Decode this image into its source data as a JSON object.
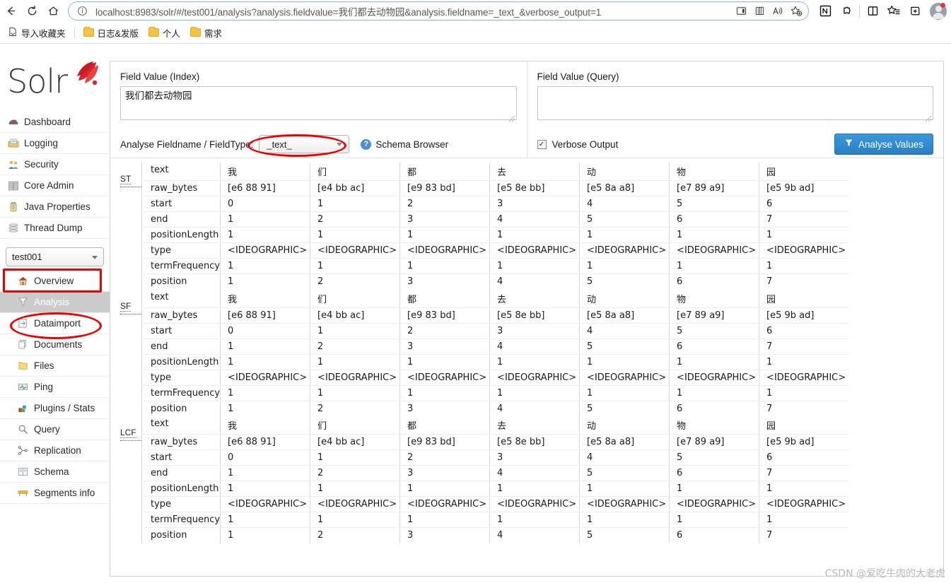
{
  "browser": {
    "back_label": "Back",
    "refresh_label": "Refresh",
    "home_label": "Home",
    "url_host": "localhost",
    "url_rest": ":8983/solr/#/test001/analysis?analysis.fieldvalue=我们都去动物园&analysis.fieldname=_text_&verbose_output=1",
    "url_full": "localhost:8983/solr/#/test001/analysis?analysis.fieldvalue=我们都去动物园&analysis.fieldname=_text_&verbose_output=1",
    "addr_icons": [
      "split-screen-icon",
      "collections-icon",
      "read-aloud-icon",
      "add-favorite-icon"
    ],
    "ext_icons": [
      "notion-icon",
      "extensions-icon",
      "split-pane-icon",
      "favorites-icon",
      "add-tab-icon"
    ],
    "bookmarks": [
      {
        "label": "导入收藏夹",
        "icon": "import-favorites-icon"
      },
      {
        "label": "日志&发版",
        "icon": "folder-icon"
      },
      {
        "label": "个人",
        "icon": "folder-icon"
      },
      {
        "label": "需求",
        "icon": "folder-icon"
      }
    ]
  },
  "sidebar": {
    "logo_text": "Solr",
    "global_items": [
      {
        "label": "Dashboard",
        "icon": "dashboard-icon"
      },
      {
        "label": "Logging",
        "icon": "logging-icon"
      },
      {
        "label": "Security",
        "icon": "security-icon"
      },
      {
        "label": "Core Admin",
        "icon": "core-admin-icon"
      },
      {
        "label": "Java Properties",
        "icon": "java-properties-icon"
      },
      {
        "label": "Thread Dump",
        "icon": "thread-dump-icon"
      }
    ],
    "core_selector_value": "test001",
    "core_items": [
      {
        "label": "Overview",
        "icon": "home-icon",
        "active": false
      },
      {
        "label": "Analysis",
        "icon": "funnel-icon",
        "active": true
      },
      {
        "label": "Dataimport",
        "icon": "dataimport-icon",
        "active": false
      },
      {
        "label": "Documents",
        "icon": "documents-icon",
        "active": false
      },
      {
        "label": "Files",
        "icon": "files-icon",
        "active": false
      },
      {
        "label": "Ping",
        "icon": "ping-icon",
        "active": false
      },
      {
        "label": "Plugins / Stats",
        "icon": "plugins-icon",
        "active": false
      },
      {
        "label": "Query",
        "icon": "magnifier-icon",
        "active": false
      },
      {
        "label": "Replication",
        "icon": "replication-icon",
        "active": false
      },
      {
        "label": "Schema",
        "icon": "schema-icon",
        "active": false
      },
      {
        "label": "Segments info",
        "icon": "segments-icon",
        "active": false
      }
    ]
  },
  "form": {
    "index_label": "Field Value (Index)",
    "index_value": "我们都去动物园",
    "index_placeholder": "",
    "query_label": "Field Value (Query)",
    "query_value": "",
    "query_placeholder": "",
    "analyse_fieldname_label": "Analyse Fieldname / FieldType:",
    "fieldtype_value": "_text_",
    "schema_browser_label": "Schema Browser",
    "verbose_label": "Verbose Output",
    "verbose_checked": true,
    "analyse_button_label": "Analyse Values"
  },
  "results": {
    "row_keys": [
      "text",
      "raw_bytes",
      "start",
      "end",
      "positionLength",
      "type",
      "termFrequency",
      "position"
    ],
    "blocks": [
      {
        "abbr": "ST",
        "tokens": [
          {
            "text": "我",
            "raw_bytes": "[e6 88 91]",
            "start": "0",
            "end": "1",
            "positionLength": "1",
            "type": "<IDEOGRAPHIC>",
            "termFrequency": "1",
            "position": "1"
          },
          {
            "text": "们",
            "raw_bytes": "[e4 bb ac]",
            "start": "1",
            "end": "2",
            "positionLength": "1",
            "type": "<IDEOGRAPHIC>",
            "termFrequency": "1",
            "position": "2"
          },
          {
            "text": "都",
            "raw_bytes": "[e9 83 bd]",
            "start": "2",
            "end": "3",
            "positionLength": "1",
            "type": "<IDEOGRAPHIC>",
            "termFrequency": "1",
            "position": "3"
          },
          {
            "text": "去",
            "raw_bytes": "[e5 8e bb]",
            "start": "3",
            "end": "4",
            "positionLength": "1",
            "type": "<IDEOGRAPHIC>",
            "termFrequency": "1",
            "position": "4"
          },
          {
            "text": "动",
            "raw_bytes": "[e5 8a a8]",
            "start": "4",
            "end": "5",
            "positionLength": "1",
            "type": "<IDEOGRAPHIC>",
            "termFrequency": "1",
            "position": "5"
          },
          {
            "text": "物",
            "raw_bytes": "[e7 89 a9]",
            "start": "5",
            "end": "6",
            "positionLength": "1",
            "type": "<IDEOGRAPHIC>",
            "termFrequency": "1",
            "position": "6"
          },
          {
            "text": "园",
            "raw_bytes": "[e5 9b ad]",
            "start": "6",
            "end": "7",
            "positionLength": "1",
            "type": "<IDEOGRAPHIC>",
            "termFrequency": "1",
            "position": "7"
          }
        ]
      },
      {
        "abbr": "SF",
        "tokens": [
          {
            "text": "我",
            "raw_bytes": "[e6 88 91]",
            "start": "0",
            "end": "1",
            "positionLength": "1",
            "type": "<IDEOGRAPHIC>",
            "termFrequency": "1",
            "position": "1"
          },
          {
            "text": "们",
            "raw_bytes": "[e4 bb ac]",
            "start": "1",
            "end": "2",
            "positionLength": "1",
            "type": "<IDEOGRAPHIC>",
            "termFrequency": "1",
            "position": "2"
          },
          {
            "text": "都",
            "raw_bytes": "[e9 83 bd]",
            "start": "2",
            "end": "3",
            "positionLength": "1",
            "type": "<IDEOGRAPHIC>",
            "termFrequency": "1",
            "position": "3"
          },
          {
            "text": "去",
            "raw_bytes": "[e5 8e bb]",
            "start": "3",
            "end": "4",
            "positionLength": "1",
            "type": "<IDEOGRAPHIC>",
            "termFrequency": "1",
            "position": "4"
          },
          {
            "text": "动",
            "raw_bytes": "[e5 8a a8]",
            "start": "4",
            "end": "5",
            "positionLength": "1",
            "type": "<IDEOGRAPHIC>",
            "termFrequency": "1",
            "position": "5"
          },
          {
            "text": "物",
            "raw_bytes": "[e7 89 a9]",
            "start": "5",
            "end": "6",
            "positionLength": "1",
            "type": "<IDEOGRAPHIC>",
            "termFrequency": "1",
            "position": "6"
          },
          {
            "text": "园",
            "raw_bytes": "[e5 9b ad]",
            "start": "6",
            "end": "7",
            "positionLength": "1",
            "type": "<IDEOGRAPHIC>",
            "termFrequency": "1",
            "position": "7"
          }
        ]
      },
      {
        "abbr": "LCF",
        "tokens": [
          {
            "text": "我",
            "raw_bytes": "[e6 88 91]",
            "start": "0",
            "end": "1",
            "positionLength": "1",
            "type": "<IDEOGRAPHIC>",
            "termFrequency": "1",
            "position": "1"
          },
          {
            "text": "们",
            "raw_bytes": "[e4 bb ac]",
            "start": "1",
            "end": "2",
            "positionLength": "1",
            "type": "<IDEOGRAPHIC>",
            "termFrequency": "1",
            "position": "2"
          },
          {
            "text": "都",
            "raw_bytes": "[e9 83 bd]",
            "start": "2",
            "end": "3",
            "positionLength": "1",
            "type": "<IDEOGRAPHIC>",
            "termFrequency": "1",
            "position": "3"
          },
          {
            "text": "去",
            "raw_bytes": "[e5 8e bb]",
            "start": "3",
            "end": "4",
            "positionLength": "1",
            "type": "<IDEOGRAPHIC>",
            "termFrequency": "1",
            "position": "4"
          },
          {
            "text": "动",
            "raw_bytes": "[e5 8a a8]",
            "start": "4",
            "end": "5",
            "positionLength": "1",
            "type": "<IDEOGRAPHIC>",
            "termFrequency": "1",
            "position": "5"
          },
          {
            "text": "物",
            "raw_bytes": "[e7 89 a9]",
            "start": "5",
            "end": "6",
            "positionLength": "1",
            "type": "<IDEOGRAPHIC>",
            "termFrequency": "1",
            "position": "6"
          },
          {
            "text": "园",
            "raw_bytes": "[e5 9b ad]",
            "start": "6",
            "end": "7",
            "positionLength": "1",
            "type": "<IDEOGRAPHIC>",
            "termFrequency": "1",
            "position": "7"
          }
        ]
      }
    ]
  },
  "watermark": "CSDN @爱吃牛肉的大老虎",
  "colors": {
    "accent_blue": "#2f8ed4",
    "annotation_red": "#ee0000",
    "solr_red": "#d9232e",
    "active_nav_bg": "#cccccc"
  }
}
